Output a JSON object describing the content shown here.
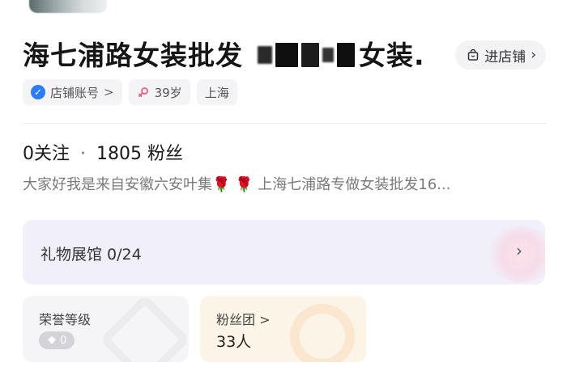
{
  "header": {
    "title": "海七浦路女装批发",
    "title_suffix": "女装.",
    "enter_shop_label": "进店铺",
    "enter_shop_chevron": "›"
  },
  "tags": [
    {
      "icon": "verified-badge-icon",
      "label": "店铺账号",
      "chevron": ">"
    },
    {
      "icon": "female-icon",
      "label": "39岁"
    },
    {
      "label": "上海"
    }
  ],
  "stats": {
    "following_count": "0",
    "following_label": "关注",
    "separator": "·",
    "followers_count": "1805",
    "followers_label": "粉丝"
  },
  "bio": {
    "part1": "大家好我是来自安徽六安叶集",
    "emoji": "🌹 🌹",
    "part2": " 上海七浦路专做女装批发16..."
  },
  "gift_hall": {
    "label": "礼物展馆",
    "count": "0/24",
    "chevron": "›"
  },
  "honor_card": {
    "title": "荣誉等级",
    "level": "0"
  },
  "fans_club_card": {
    "title": "粉丝团",
    "chevron": ">",
    "count": "33人"
  },
  "colors": {
    "accent_blue": "#2d7cf6",
    "gift_bg": "#f1effa",
    "fans_bg": "#fdf4e8"
  }
}
